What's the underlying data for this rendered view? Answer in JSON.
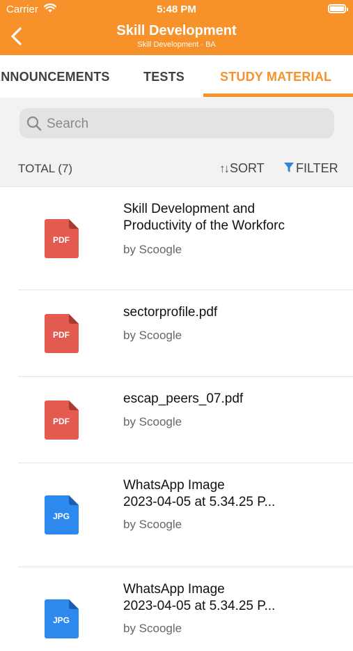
{
  "status_bar": {
    "carrier": "Carrier",
    "time": "5:48 PM"
  },
  "header": {
    "title": "Skill Development",
    "subtitle": "Skill Development · BA",
    "back_icon": "chevron-left-icon",
    "color": "#F7922B"
  },
  "tabs": [
    {
      "label": "ANNOUNCEMENTS",
      "active": false
    },
    {
      "label": "TESTS",
      "active": false
    },
    {
      "label": "STUDY MATERIAL",
      "active": true
    }
  ],
  "search": {
    "placeholder": "Search",
    "value": ""
  },
  "list_header": {
    "total": "TOTAL (7)",
    "sort_label": "SORT",
    "filter_label": "FILTER"
  },
  "colors": {
    "pdf": "#E35A4F",
    "jpg": "#2E89EE",
    "filter_icon": "#2F86D9"
  },
  "items": [
    {
      "name_line1": "Skill Development and",
      "name_line2": "Productivity of the Workforc",
      "author": "by Scoogle",
      "type": "PDF"
    },
    {
      "name_line1": "sectorprofile.pdf",
      "author": "by Scoogle",
      "type": "PDF"
    },
    {
      "name_line1": "escap_peers_07.pdf",
      "author": "by Scoogle",
      "type": "PDF"
    },
    {
      "name_line1": "WhatsApp Image",
      "name_line2": "2023-04-05 at 5.34.25 P...",
      "author": "by Scoogle",
      "type": "JPG"
    },
    {
      "name_line1": "WhatsApp Image",
      "name_line2": "2023-04-05 at 5.34.25 P...",
      "author": "by Scoogle",
      "type": "JPG"
    }
  ]
}
